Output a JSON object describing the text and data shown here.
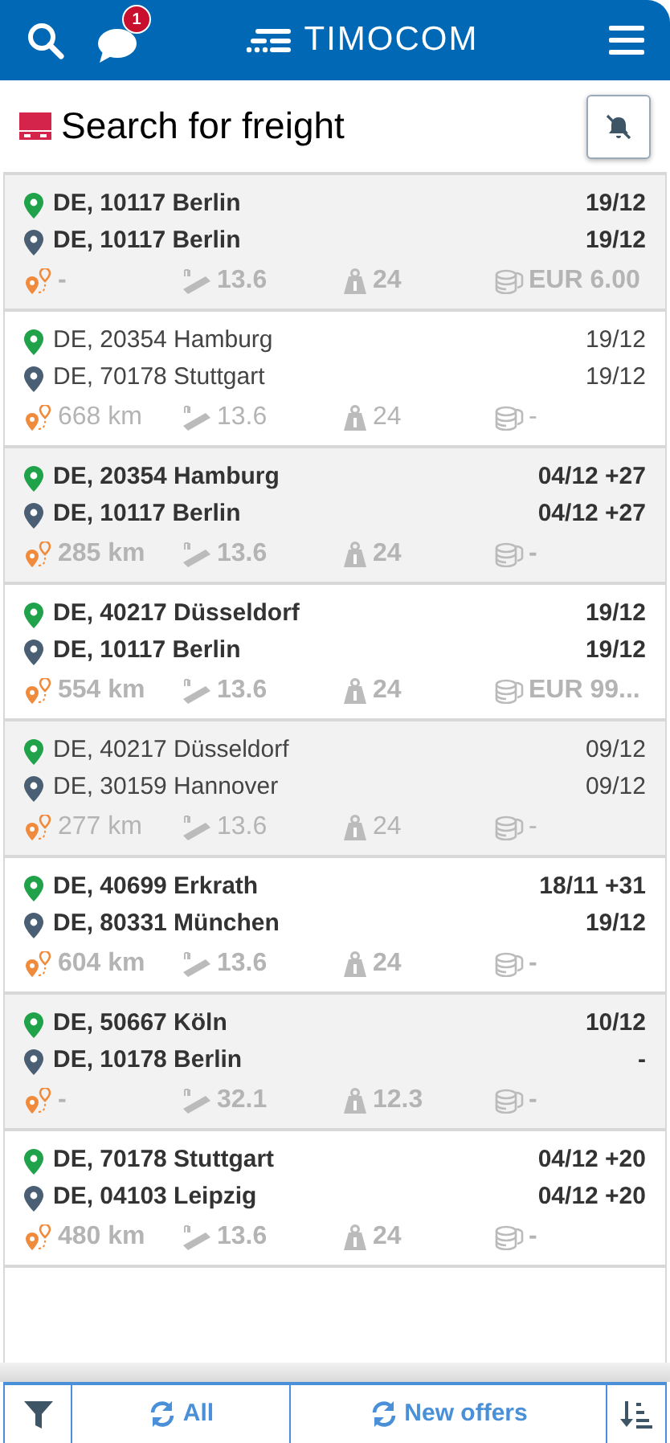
{
  "header": {
    "logo": "TIMOCOM",
    "message_badge": "1"
  },
  "title": "Search for freight",
  "offers": [
    {
      "new": true,
      "origin": "DE, 10117 Berlin",
      "destination": "DE, 10117 Berlin",
      "origin_date": "19/12",
      "destination_date": "19/12",
      "distance": "-",
      "length": "13.6",
      "weight": "24",
      "price": "EUR 6.00"
    },
    {
      "new": false,
      "origin": "DE, 20354 Hamburg",
      "destination": "DE, 70178 Stuttgart",
      "origin_date": "19/12",
      "destination_date": "19/12",
      "distance": "668 km",
      "length": "13.6",
      "weight": "24",
      "price": "-"
    },
    {
      "new": true,
      "origin": "DE, 20354 Hamburg",
      "destination": "DE, 10117 Berlin",
      "origin_date": "04/12 +27",
      "destination_date": "04/12 +27",
      "distance": "285 km",
      "length": "13.6",
      "weight": "24",
      "price": "-"
    },
    {
      "new": true,
      "origin": "DE, 40217 Düsseldorf",
      "destination": "DE, 10117 Berlin",
      "origin_date": "19/12",
      "destination_date": "19/12",
      "distance": "554 km",
      "length": "13.6",
      "weight": "24",
      "price": "EUR 99..."
    },
    {
      "new": false,
      "origin": "DE, 40217 Düsseldorf",
      "destination": "DE, 30159 Hannover",
      "origin_date": "09/12",
      "destination_date": "09/12",
      "distance": "277 km",
      "length": "13.6",
      "weight": "24",
      "price": "-"
    },
    {
      "new": true,
      "origin": "DE, 40699 Erkrath",
      "destination": "DE, 80331 München",
      "origin_date": "18/11 +31",
      "destination_date": "19/12",
      "distance": "604 km",
      "length": "13.6",
      "weight": "24",
      "price": "-"
    },
    {
      "new": true,
      "origin": "DE, 50667 Köln",
      "destination": "DE, 10178 Berlin",
      "origin_date": "10/12",
      "destination_date": "-",
      "distance": "-",
      "length": "32.1",
      "weight": "12.3",
      "price": "-"
    },
    {
      "new": true,
      "origin": "DE, 70178 Stuttgart",
      "destination": "DE, 04103 Leipzig",
      "origin_date": "04/12 +20",
      "destination_date": "04/12 +20",
      "distance": "480 km",
      "length": "13.6",
      "weight": "24",
      "price": "-"
    }
  ],
  "footer": {
    "all_label": "All",
    "new_offers_label": "New offers"
  }
}
